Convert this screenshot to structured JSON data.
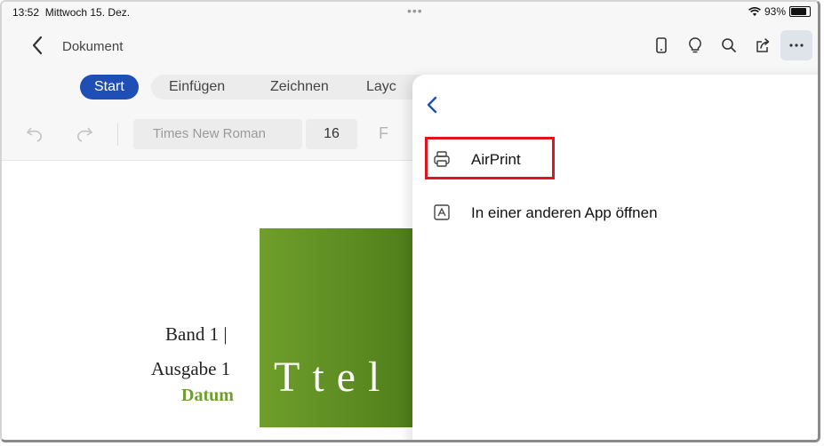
{
  "status": {
    "time": "13:52",
    "date": "Mittwoch 15. Dez.",
    "dots": "•••",
    "battery": "93%"
  },
  "nav": {
    "title": "Dokument"
  },
  "tabs": [
    "Start",
    "Einfügen",
    "Zeichnen",
    "Layc"
  ],
  "toolbar": {
    "font": "Times New Roman",
    "size": "16",
    "bold": "F"
  },
  "document": {
    "band": "Band 1 |",
    "ausgabe": "Ausgabe 1",
    "datum": "Datum",
    "title": "Ttel"
  },
  "menu": {
    "items": [
      {
        "label": "AirPrint",
        "icon": "printer-icon"
      },
      {
        "label": "In einer anderen App öffnen",
        "icon": "open-in-app-icon"
      }
    ]
  },
  "colors": {
    "accent": "#1f4fb4",
    "highlight": "#e0141e",
    "cover": "#5f8f23",
    "datum": "#6f9e2b"
  }
}
